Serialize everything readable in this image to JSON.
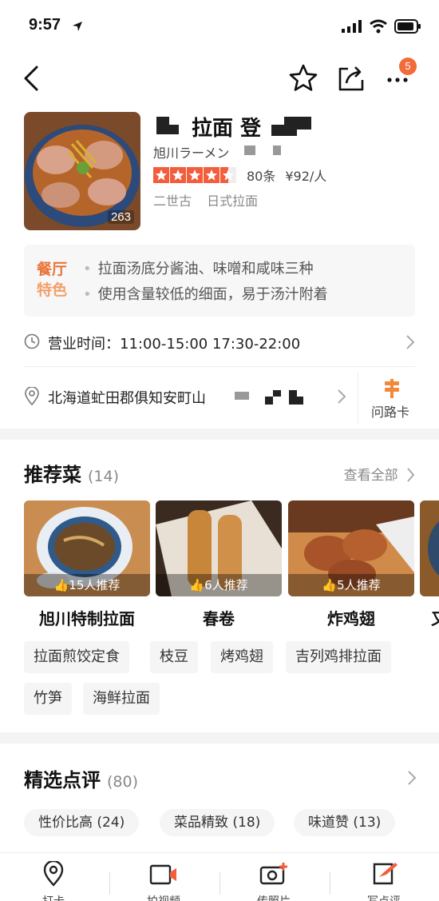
{
  "status": {
    "time": "9:57"
  },
  "nav": {
    "badge_count": "5"
  },
  "shop": {
    "name": "拉面 登",
    "subtitle": "旭川ラーメン",
    "photo_count": "263",
    "rating_stars": 4.5,
    "review_count": "80条",
    "price": "¥92/人",
    "area": "二世古",
    "cuisine": "日式拉面"
  },
  "features": {
    "label_line1": "餐厅",
    "label_line2": "特色",
    "items": [
      "拉面汤底分酱油、味噌和咸味三种",
      "使用含量较低的细面，易于汤汁附着"
    ]
  },
  "hours": {
    "text": "营业时间：11:00-15:00 17:30-22:00"
  },
  "address": {
    "text": "北海道虻田郡俱知安町山",
    "route_label": "问路卡"
  },
  "recommended": {
    "title": "推荐菜",
    "count": "(14)",
    "see_all": "查看全部",
    "dishes": [
      {
        "name": "旭川特制拉面",
        "rec": "15人推荐"
      },
      {
        "name": "春卷",
        "rec": "6人推荐"
      },
      {
        "name": "炸鸡翅",
        "rec": "5人推荐"
      },
      {
        "name": "又"
      }
    ],
    "chips": [
      "拉面煎饺定食",
      "枝豆",
      "烤鸡翅",
      "吉列鸡排拉面",
      "竹笋",
      "海鲜拉面"
    ]
  },
  "reviews": {
    "title": "精选点评",
    "count": "(80)",
    "tags": [
      "性价比高 (24)",
      "菜品精致 (18)",
      "味道赞 (13)"
    ]
  },
  "tabbar": {
    "items": [
      "打卡",
      "拍视频",
      "传照片",
      "写点评"
    ]
  },
  "colors": {
    "accent": "#f35d3b",
    "feature_orange": "#e8753a"
  }
}
